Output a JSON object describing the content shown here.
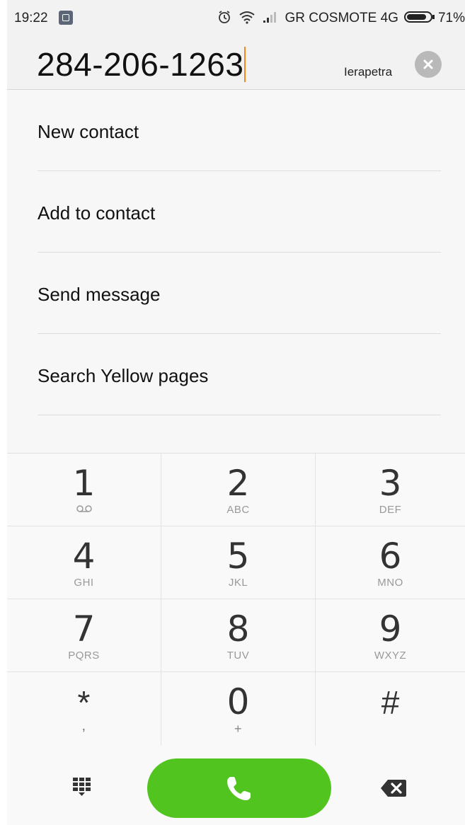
{
  "status_bar": {
    "time": "19:22",
    "carrier": "GR COSMOTE 4G",
    "battery": "71%",
    "icons": [
      "app-notification-icon",
      "alarm-icon",
      "wifi-icon",
      "signal-icon",
      "battery-icon"
    ]
  },
  "dialer": {
    "number": "284-206-1263",
    "location": "Ierapetra",
    "accent_color": "#f08a1f"
  },
  "options": [
    {
      "label": "New contact"
    },
    {
      "label": "Add to contact"
    },
    {
      "label": "Send message"
    },
    {
      "label": "Search Yellow pages"
    }
  ],
  "keypad": {
    "keys": [
      {
        "digit": "1",
        "letters": ""
      },
      {
        "digit": "2",
        "letters": "ABC"
      },
      {
        "digit": "3",
        "letters": "DEF"
      },
      {
        "digit": "4",
        "letters": "GHI"
      },
      {
        "digit": "5",
        "letters": "JKL"
      },
      {
        "digit": "6",
        "letters": "MNO"
      },
      {
        "digit": "7",
        "letters": "PQRS"
      },
      {
        "digit": "8",
        "letters": "TUV"
      },
      {
        "digit": "9",
        "letters": "WXYZ"
      },
      {
        "digit": "*",
        "letters": ","
      },
      {
        "digit": "0",
        "letters": "+"
      },
      {
        "digit": "#",
        "letters": ""
      }
    ]
  },
  "actions": {
    "call_color": "#52c41f",
    "icons": [
      "keypad-grid-icon",
      "phone-icon",
      "backspace-icon"
    ]
  }
}
